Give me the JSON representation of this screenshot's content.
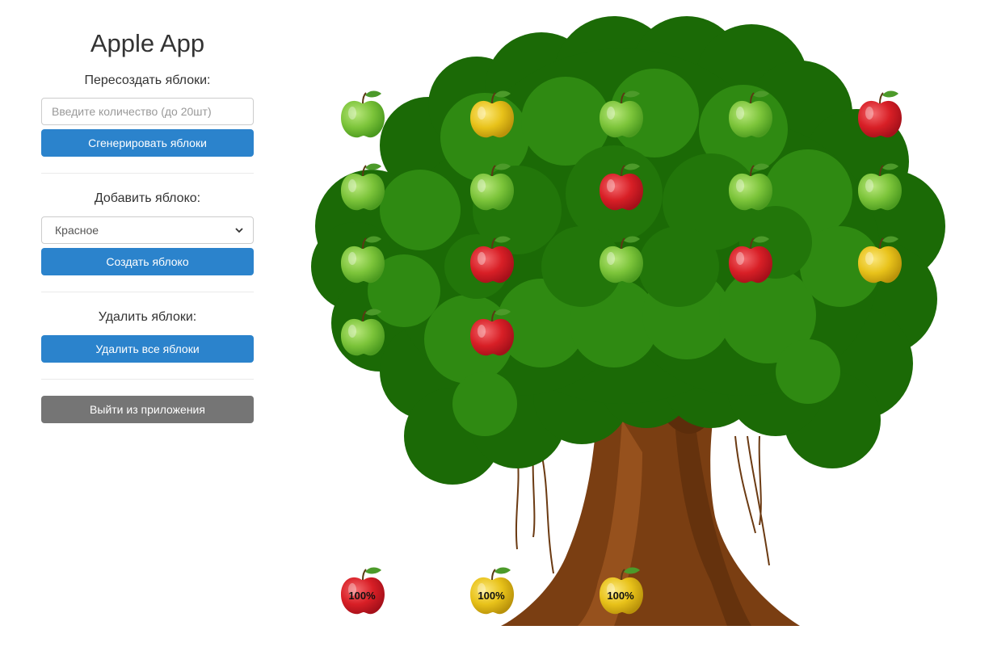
{
  "app": {
    "title": "Apple App"
  },
  "regen": {
    "label": "Пересоздать яблоки:",
    "placeholder": "Введите количество (до 20шт)",
    "button": "Сгенерировать яблоки"
  },
  "add": {
    "label": "Добавить яблоко:",
    "selected": "Красное",
    "button": "Создать яблоко"
  },
  "remove": {
    "label": "Удалить яблоки:",
    "button": "Удалить все яблоки"
  },
  "exit": {
    "button": "Выйти из приложения"
  },
  "colors": {
    "primary": "#2b83cc",
    "secondary": "#757575",
    "red": "#d81f26",
    "yellow": "#e8c21a",
    "green": "#7cc43a"
  },
  "apples_on_tree": [
    [
      "green",
      "yellow",
      "green",
      "green",
      "red"
    ],
    [
      "green",
      "green",
      "red",
      "green",
      "green"
    ],
    [
      "green",
      "red",
      "green",
      "red",
      "yellow"
    ],
    [
      "green",
      "red"
    ]
  ],
  "fallen_apples": [
    {
      "color": "red",
      "percent": "100%"
    },
    {
      "color": "yellow",
      "percent": "100%"
    },
    {
      "color": "yellow",
      "percent": "100%"
    }
  ]
}
